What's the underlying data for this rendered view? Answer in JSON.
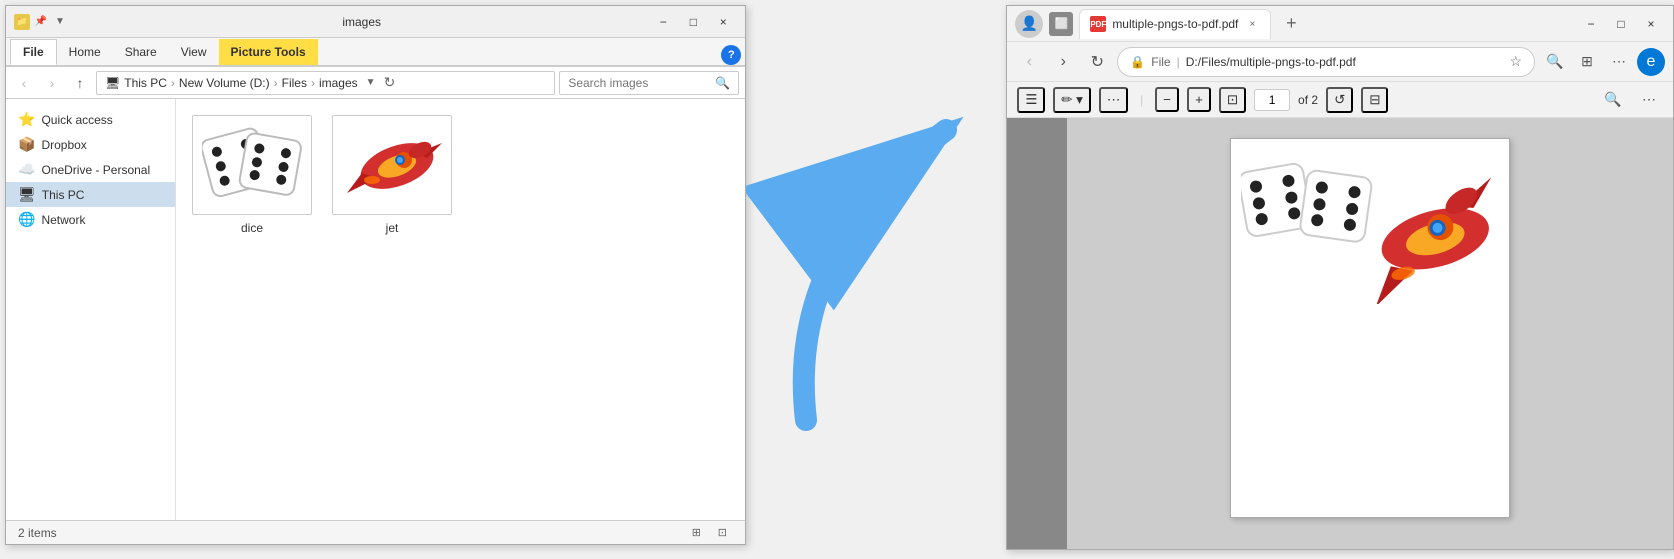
{
  "explorer": {
    "title": "images",
    "ribbon_tabs": [
      "File",
      "Home",
      "Share",
      "View",
      "Picture Tools"
    ],
    "active_tab": "Picture Tools",
    "address": {
      "parts": [
        "This PC",
        "New Volume (D:)",
        "Files",
        "images"
      ]
    },
    "search_placeholder": "Search images",
    "sidebar_items": [
      {
        "label": "Quick access",
        "icon": "⭐"
      },
      {
        "label": "Dropbox",
        "icon": "📦"
      },
      {
        "label": "OneDrive - Personal",
        "icon": "☁️"
      },
      {
        "label": "This PC",
        "icon": "🖥"
      },
      {
        "label": "Network",
        "icon": "🌐"
      }
    ],
    "files": [
      {
        "name": "dice",
        "type": "image"
      },
      {
        "name": "jet",
        "type": "image"
      }
    ],
    "status": "2 items",
    "window_controls": [
      "−",
      "□",
      "×"
    ]
  },
  "browser": {
    "tab_title": "multiple-pngs-to-pdf.pdf",
    "url": "D:/Files/multiple-pngs-to-pdf.pdf",
    "url_protocol": "File",
    "page_current": "1",
    "page_total": "of 2",
    "toolbar_buttons": [
      "−",
      "+"
    ],
    "window_controls": [
      "−",
      "□",
      "×"
    ]
  },
  "arrow": {
    "color": "#5aabf0",
    "description": "curved arrow pointing right"
  }
}
